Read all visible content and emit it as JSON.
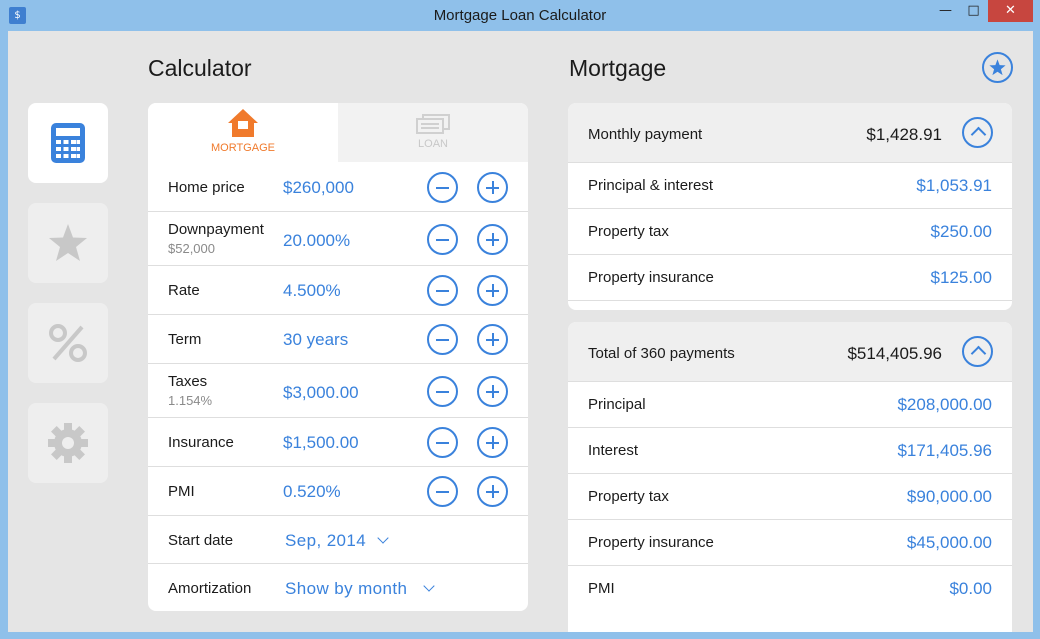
{
  "window": {
    "title": "Mortgage Loan Calculator",
    "icon": "calculator-app-icon"
  },
  "sidebar": {
    "items": [
      {
        "name": "calculator",
        "icon": "calculator-icon",
        "active": true
      },
      {
        "name": "favorites",
        "icon": "star-icon",
        "active": false
      },
      {
        "name": "rates",
        "icon": "percent-icon",
        "active": false
      },
      {
        "name": "settings",
        "icon": "gear-icon",
        "active": false
      }
    ]
  },
  "calculator": {
    "title": "Calculator",
    "tabs": [
      {
        "label": "MORTGAGE",
        "icon": "house-icon",
        "active": true
      },
      {
        "label": "LOAN",
        "icon": "money-icon",
        "active": false
      }
    ],
    "fields": [
      {
        "label": "Home price",
        "sub": "",
        "value": "$260,000"
      },
      {
        "label": "Downpayment",
        "sub": "$52,000",
        "value": "20.000%"
      },
      {
        "label": "Rate",
        "sub": "",
        "value": "4.500%"
      },
      {
        "label": "Term",
        "sub": "",
        "value": "30 years"
      },
      {
        "label": "Taxes",
        "sub": "1.154%",
        "value": "$3,000.00"
      },
      {
        "label": "Insurance",
        "sub": "",
        "value": "$1,500.00"
      },
      {
        "label": "PMI",
        "sub": "",
        "value": "0.520%"
      }
    ],
    "start_date": {
      "label": "Start date",
      "value": "Sep, 2014"
    },
    "amortization": {
      "label": "Amortization",
      "value": "Show by month"
    }
  },
  "mortgage": {
    "title": "Mortgage",
    "monthly": {
      "label": "Monthly payment",
      "total": "$1,428.91",
      "rows": [
        {
          "label": "Principal & interest",
          "value": "$1,053.91"
        },
        {
          "label": "Property tax",
          "value": "$250.00"
        },
        {
          "label": "Property insurance",
          "value": "$125.00"
        }
      ]
    },
    "total": {
      "label": "Total of 360 payments",
      "total": "$514,405.96",
      "rows": [
        {
          "label": "Principal",
          "value": "$208,000.00"
        },
        {
          "label": "Interest",
          "value": "$171,405.96"
        },
        {
          "label": "Property tax",
          "value": "$90,000.00"
        },
        {
          "label": "Property insurance",
          "value": "$45,000.00"
        },
        {
          "label": "PMI",
          "value": "$0.00"
        }
      ]
    }
  },
  "colors": {
    "accent": "#3a82dc",
    "orange": "#f07a2c",
    "titlebar": "#8fc0ea",
    "close": "#c7463f"
  }
}
